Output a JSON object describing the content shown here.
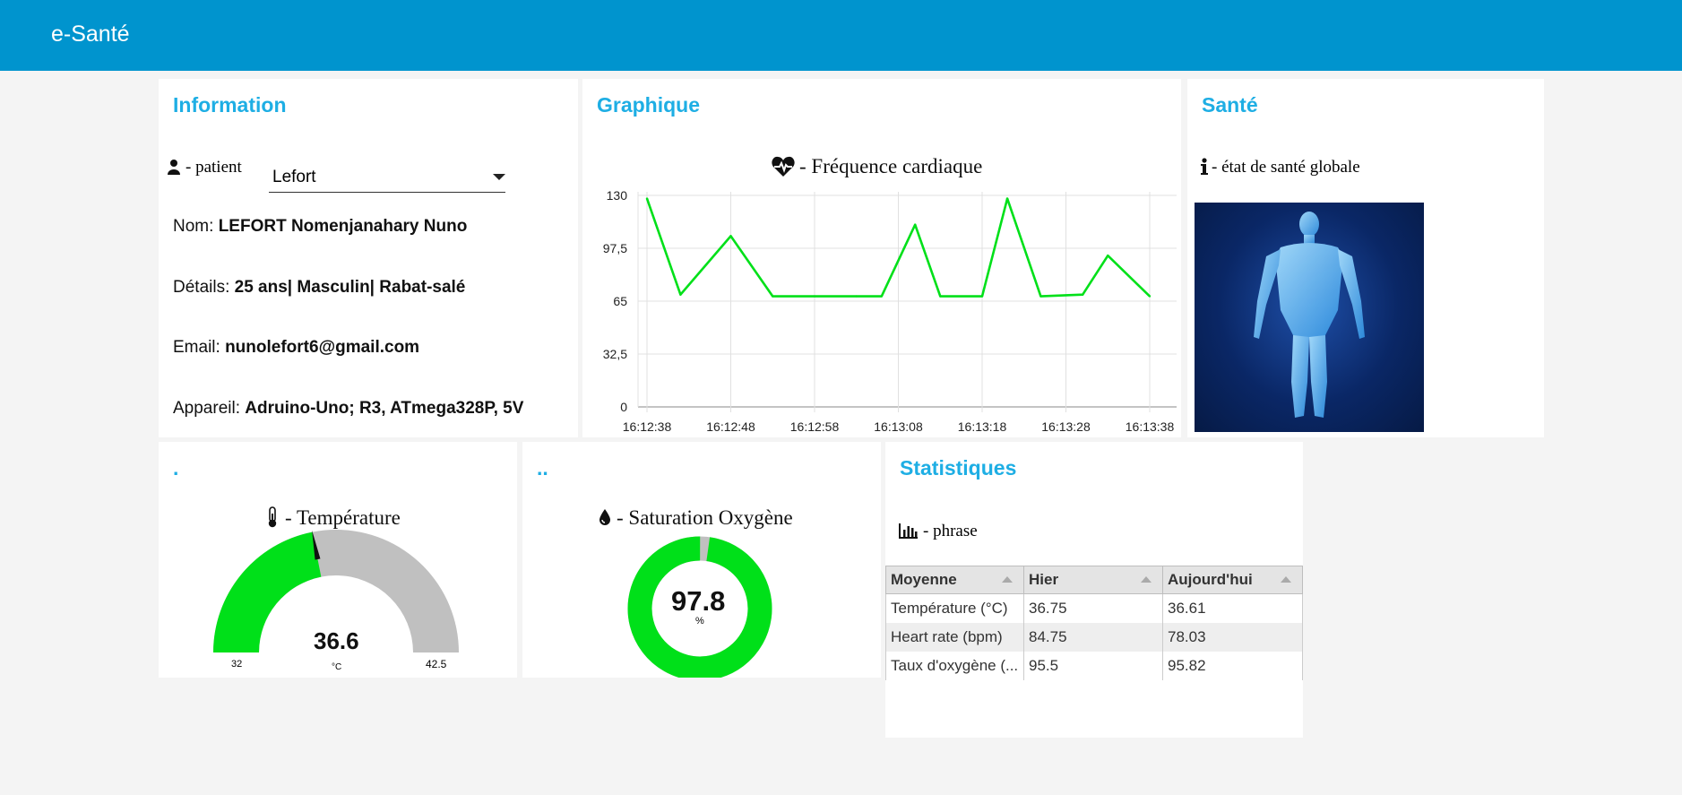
{
  "app": {
    "title": "e-Santé"
  },
  "info": {
    "title": "Information",
    "patient_label": "- patient",
    "patient_selected": "Lefort",
    "nom_label": "Nom:",
    "nom_value": "LEFORT Nomenjanahary Nuno",
    "details_label": "Détails:",
    "details_value": "25 ans| Masculin| Rabat-salé",
    "email_label": "Email:",
    "email_value": "nunolefort6@gmail.com",
    "appareil_label": "Appareil:",
    "appareil_value": "Adruino-Uno; R3, ATmega328P, 5V"
  },
  "graph": {
    "title": "Graphique",
    "chart_title": "- Fréquence cardiaque"
  },
  "sante": {
    "title": "Santé",
    "label": "- état de santé globale"
  },
  "temp": {
    "title": ".",
    "label": "- Température",
    "value": "36.6",
    "unit": "°C",
    "min": "32",
    "max": "42.5"
  },
  "oxy": {
    "title": "..",
    "label": "- Saturation Oxygène",
    "value": "97.8",
    "unit": "%"
  },
  "stats": {
    "title": "Statistiques",
    "label": "- phrase",
    "headers": [
      "Moyenne",
      "Hier",
      "Aujourd'hui"
    ],
    "rows": [
      [
        "Température (°C)",
        "36.75",
        "36.61"
      ],
      [
        "Heart rate (bpm)",
        "84.75",
        "78.03"
      ],
      [
        "Taux d'oxygène (...",
        "95.5",
        "95.82"
      ]
    ]
  },
  "colors": {
    "header_bg": "#0094ce",
    "title": "#1eaee4",
    "series": "#00e019",
    "gauge_bg": "#c0c0c0"
  },
  "chart_data": [
    {
      "type": "line",
      "title": "- Fréquence cardiaque",
      "ylim": [
        0,
        130
      ],
      "yticks": [
        "0",
        "32,5",
        "65",
        "97,5",
        "130"
      ],
      "xtick_labels": [
        "16:12:38",
        "16:12:48",
        "16:12:58",
        "16:13:08",
        "16:13:18",
        "16:13:28",
        "16:13:38"
      ],
      "x": [
        "16:12:38",
        "16:12:42",
        "16:12:48",
        "16:12:53",
        "16:12:58",
        "16:13:03",
        "16:13:06",
        "16:13:10",
        "16:13:13",
        "16:13:18",
        "16:13:21",
        "16:13:25",
        "16:13:30",
        "16:13:33",
        "16:13:38"
      ],
      "values": [
        128,
        69,
        105,
        68,
        68,
        68,
        68,
        112,
        68,
        68,
        128,
        68,
        69,
        93,
        68
      ],
      "grid": true
    },
    {
      "type": "gauge",
      "title": "- Température",
      "value": 36.6,
      "range": [
        32,
        42.5
      ],
      "unit": "°C"
    },
    {
      "type": "pie",
      "title": "- Saturation Oxygène",
      "value": 97.8,
      "range": [
        0,
        100
      ],
      "unit": "%"
    }
  ]
}
